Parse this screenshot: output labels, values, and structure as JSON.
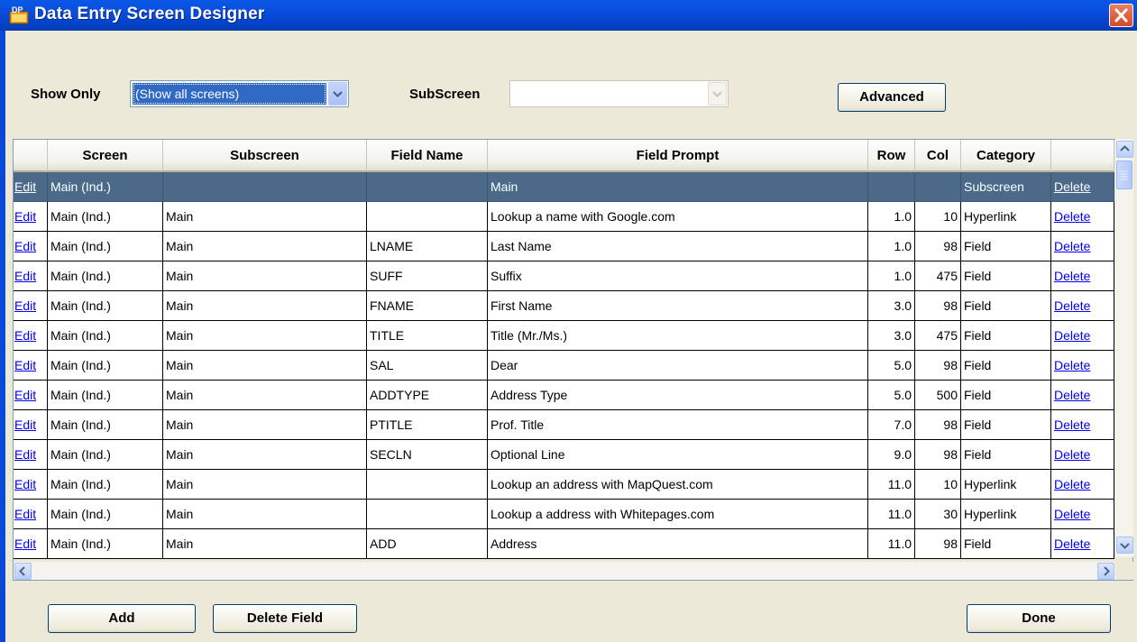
{
  "window": {
    "title": "Data Entry Screen Designer"
  },
  "toolbar": {
    "show_only_label": "Show Only",
    "show_only_value": "(Show all screens)",
    "subscreen_label": "SubScreen",
    "subscreen_value": "",
    "advanced_label": "Advanced"
  },
  "grid": {
    "columns": [
      "",
      "Screen",
      "Subscreen",
      "Field Name",
      "Field Prompt",
      "Row",
      "Col",
      "Category",
      ""
    ],
    "rows": [
      {
        "edit": "Edit",
        "screen": "Main (Ind.)",
        "subscreen": "",
        "field": "",
        "prompt": "Main",
        "row": "",
        "col": "",
        "category": "Subscreen",
        "delete": "Delete",
        "selected": true
      },
      {
        "edit": "Edit",
        "screen": "Main (Ind.)",
        "subscreen": "Main",
        "field": "",
        "prompt": "Lookup a name with Google.com",
        "row": "1.0",
        "col": "10",
        "category": "Hyperlink",
        "delete": "Delete"
      },
      {
        "edit": "Edit",
        "screen": "Main (Ind.)",
        "subscreen": "Main",
        "field": "LNAME",
        "prompt": "Last Name",
        "row": "1.0",
        "col": "98",
        "category": "Field",
        "delete": "Delete"
      },
      {
        "edit": "Edit",
        "screen": "Main (Ind.)",
        "subscreen": "Main",
        "field": "SUFF",
        "prompt": "Suffix",
        "row": "1.0",
        "col": "475",
        "category": "Field",
        "delete": "Delete"
      },
      {
        "edit": "Edit",
        "screen": "Main (Ind.)",
        "subscreen": "Main",
        "field": "FNAME",
        "prompt": "First Name",
        "row": "3.0",
        "col": "98",
        "category": "Field",
        "delete": "Delete"
      },
      {
        "edit": "Edit",
        "screen": "Main (Ind.)",
        "subscreen": "Main",
        "field": "TITLE",
        "prompt": "Title (Mr./Ms.)",
        "row": "3.0",
        "col": "475",
        "category": "Field",
        "delete": "Delete"
      },
      {
        "edit": "Edit",
        "screen": "Main (Ind.)",
        "subscreen": "Main",
        "field": "SAL",
        "prompt": "Dear",
        "row": "5.0",
        "col": "98",
        "category": "Field",
        "delete": "Delete"
      },
      {
        "edit": "Edit",
        "screen": "Main (Ind.)",
        "subscreen": "Main",
        "field": "ADDTYPE",
        "prompt": "Address Type",
        "row": "5.0",
        "col": "500",
        "category": "Field",
        "delete": "Delete"
      },
      {
        "edit": "Edit",
        "screen": "Main (Ind.)",
        "subscreen": "Main",
        "field": "PTITLE",
        "prompt": "Prof. Title",
        "row": "7.0",
        "col": "98",
        "category": "Field",
        "delete": "Delete"
      },
      {
        "edit": "Edit",
        "screen": "Main (Ind.)",
        "subscreen": "Main",
        "field": "SECLN",
        "prompt": "Optional Line",
        "row": "9.0",
        "col": "98",
        "category": "Field",
        "delete": "Delete"
      },
      {
        "edit": "Edit",
        "screen": "Main (Ind.)",
        "subscreen": "Main",
        "field": "",
        "prompt": "Lookup an address with MapQuest.com",
        "row": "11.0",
        "col": "10",
        "category": "Hyperlink",
        "delete": "Delete"
      },
      {
        "edit": "Edit",
        "screen": "Main (Ind.)",
        "subscreen": "Main",
        "field": "",
        "prompt": "Lookup a address with Whitepages.com",
        "row": "11.0",
        "col": "30",
        "category": "Hyperlink",
        "delete": "Delete"
      },
      {
        "edit": "Edit",
        "screen": "Main (Ind.)",
        "subscreen": "Main",
        "field": "ADD",
        "prompt": "Address",
        "row": "11.0",
        "col": "98",
        "category": "Field",
        "delete": "Delete"
      }
    ]
  },
  "footer": {
    "add_label": "Add",
    "delete_field_label": "Delete Field",
    "done_label": "Done"
  }
}
